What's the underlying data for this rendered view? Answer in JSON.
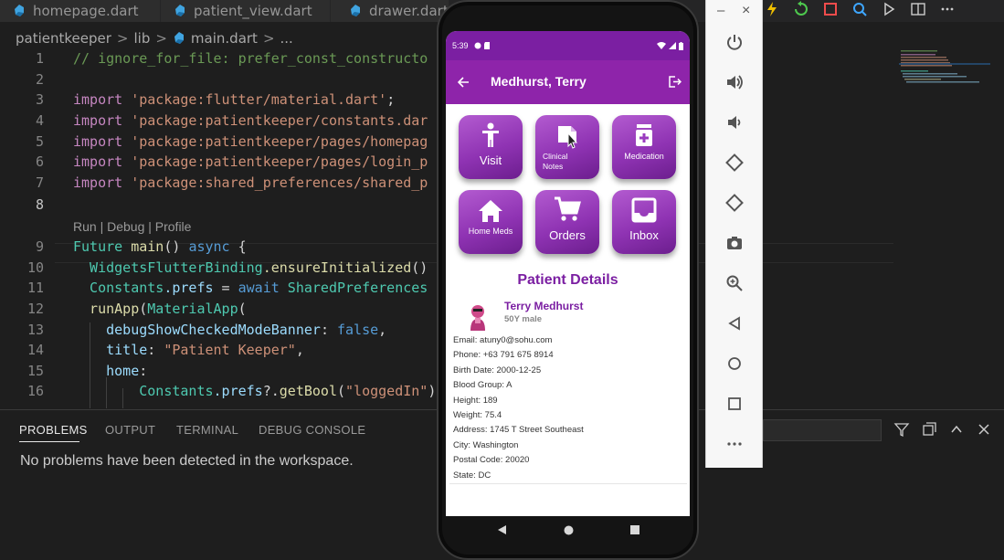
{
  "vscode": {
    "tabs": [
      {
        "label": "homepage.dart"
      },
      {
        "label": "patient_view.dart"
      },
      {
        "label": "drawer.dart"
      }
    ],
    "breadcrumb": {
      "project": "patientkeeper",
      "sep": ">",
      "folder": "lib",
      "file": "main.dart",
      "rest": "..."
    },
    "codelens": "Run | Debug | Profile",
    "line_numbers": [
      "1",
      "2",
      "3",
      "4",
      "5",
      "6",
      "7",
      "8",
      "9",
      "10",
      "11",
      "12",
      "13",
      "14",
      "15",
      "16"
    ],
    "code": {
      "l1": "// ignore_for_file: prefer_const_constructo",
      "l3_kw": "import",
      "l3_str": "'package:flutter/material.dart'",
      "l3_end": ";",
      "l4_kw": "import",
      "l4_str": "'package:patientkeeper/constants.dar",
      "l5_kw": "import",
      "l5_str": "'package:patientkeeper/pages/homepag",
      "l6_kw": "import",
      "l6_str": "'package:patientkeeper/pages/login_p",
      "l7_kw": "import",
      "l7_str": "'package:shared_preferences/shared_p",
      "l9_a": "Future",
      "l9_b": " main",
      "l9_c": "() ",
      "l9_d": "async",
      "l9_e": " {",
      "l10_a": "  WidgetsFlutterBinding",
      "l10_b": ".ensureInitialized",
      "l10_c": "()",
      "l11_a": "  Constants",
      "l11_b": ".prefs",
      "l11_c": " = ",
      "l11_d": "await",
      "l11_e": " SharedPreferences",
      "l12_a": "  runApp",
      "l12_b": "(",
      "l12_c": "MaterialApp",
      "l12_d": "(",
      "l13_a": "    debugShowCheckedModeBanner",
      "l13_b": ": ",
      "l13_c": "false",
      "l13_d": ",",
      "l14_a": "    title",
      "l14_b": ": ",
      "l14_c": "\"Patient Keeper\"",
      "l14_d": ",",
      "l15_a": "    home",
      "l15_b": ":",
      "l16_a": "        Constants",
      "l16_b": ".prefs",
      "l16_c": "?.",
      "l16_d": "getBool",
      "l16_e": "(",
      "l16_f": "\"loggedIn\"",
      "l16_g": ")"
    },
    "panel": {
      "tabs": [
        "PROBLEMS",
        "OUTPUT",
        "TERMINAL",
        "DEBUG CONSOLE"
      ],
      "message": "No problems have been detected in the workspace."
    }
  },
  "emulator": {
    "minimize": "–",
    "close": "×",
    "controls": [
      "power-icon",
      "volume-up-icon",
      "volume-down-icon",
      "rotate-left-icon",
      "rotate-right-icon",
      "camera-icon",
      "zoom-icon",
      "back-icon",
      "home-icon",
      "overview-icon",
      "more-icon"
    ]
  },
  "phone": {
    "status_time": "5:39",
    "appbar_title": "Medhurst, Terry",
    "tiles": [
      {
        "label": "Visit"
      },
      {
        "label": "Clinical Notes"
      },
      {
        "label": "Medication"
      },
      {
        "label": "Home Meds"
      },
      {
        "label": "Orders"
      },
      {
        "label": "Inbox"
      }
    ],
    "section_title": "Patient Details",
    "patient": {
      "name": "Terry Medhurst",
      "sub": "50Y male",
      "details": [
        "Email: atuny0@sohu.com",
        "Phone: +63 791 675 8914",
        "Birth Date: 2000-12-25",
        "Blood Group: A",
        "Height: 189",
        "Weight: 75.4",
        "Address: 1745 T Street Southeast",
        "City: Washington",
        "Postal Code: 20020",
        "State: DC"
      ]
    }
  },
  "colors": {
    "appbar": "#8e24aa",
    "statusbar": "#7b1fa2",
    "accent_purple": "#7b1fa2"
  }
}
